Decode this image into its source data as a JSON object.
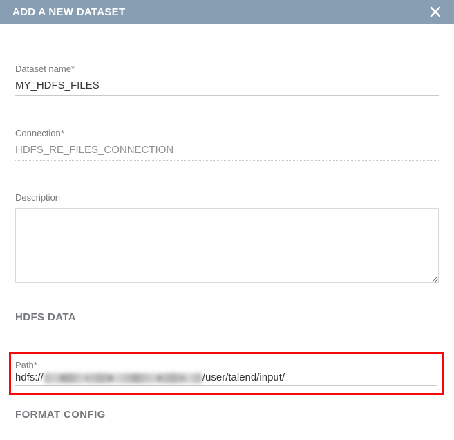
{
  "header": {
    "title": "ADD A NEW DATASET"
  },
  "fields": {
    "dataset_name": {
      "label": "Dataset name*",
      "value": "MY_HDFS_FILES"
    },
    "connection": {
      "label": "Connection*",
      "value": "HDFS_RE_FILES_CONNECTION"
    },
    "description": {
      "label": "Description",
      "value": ""
    },
    "path": {
      "label": "Path*",
      "prefix": "hdfs://",
      "suffix": "/user/talend/input/"
    }
  },
  "sections": {
    "hdfs": "HDFS DATA",
    "format": "FORMAT CONFIG"
  }
}
